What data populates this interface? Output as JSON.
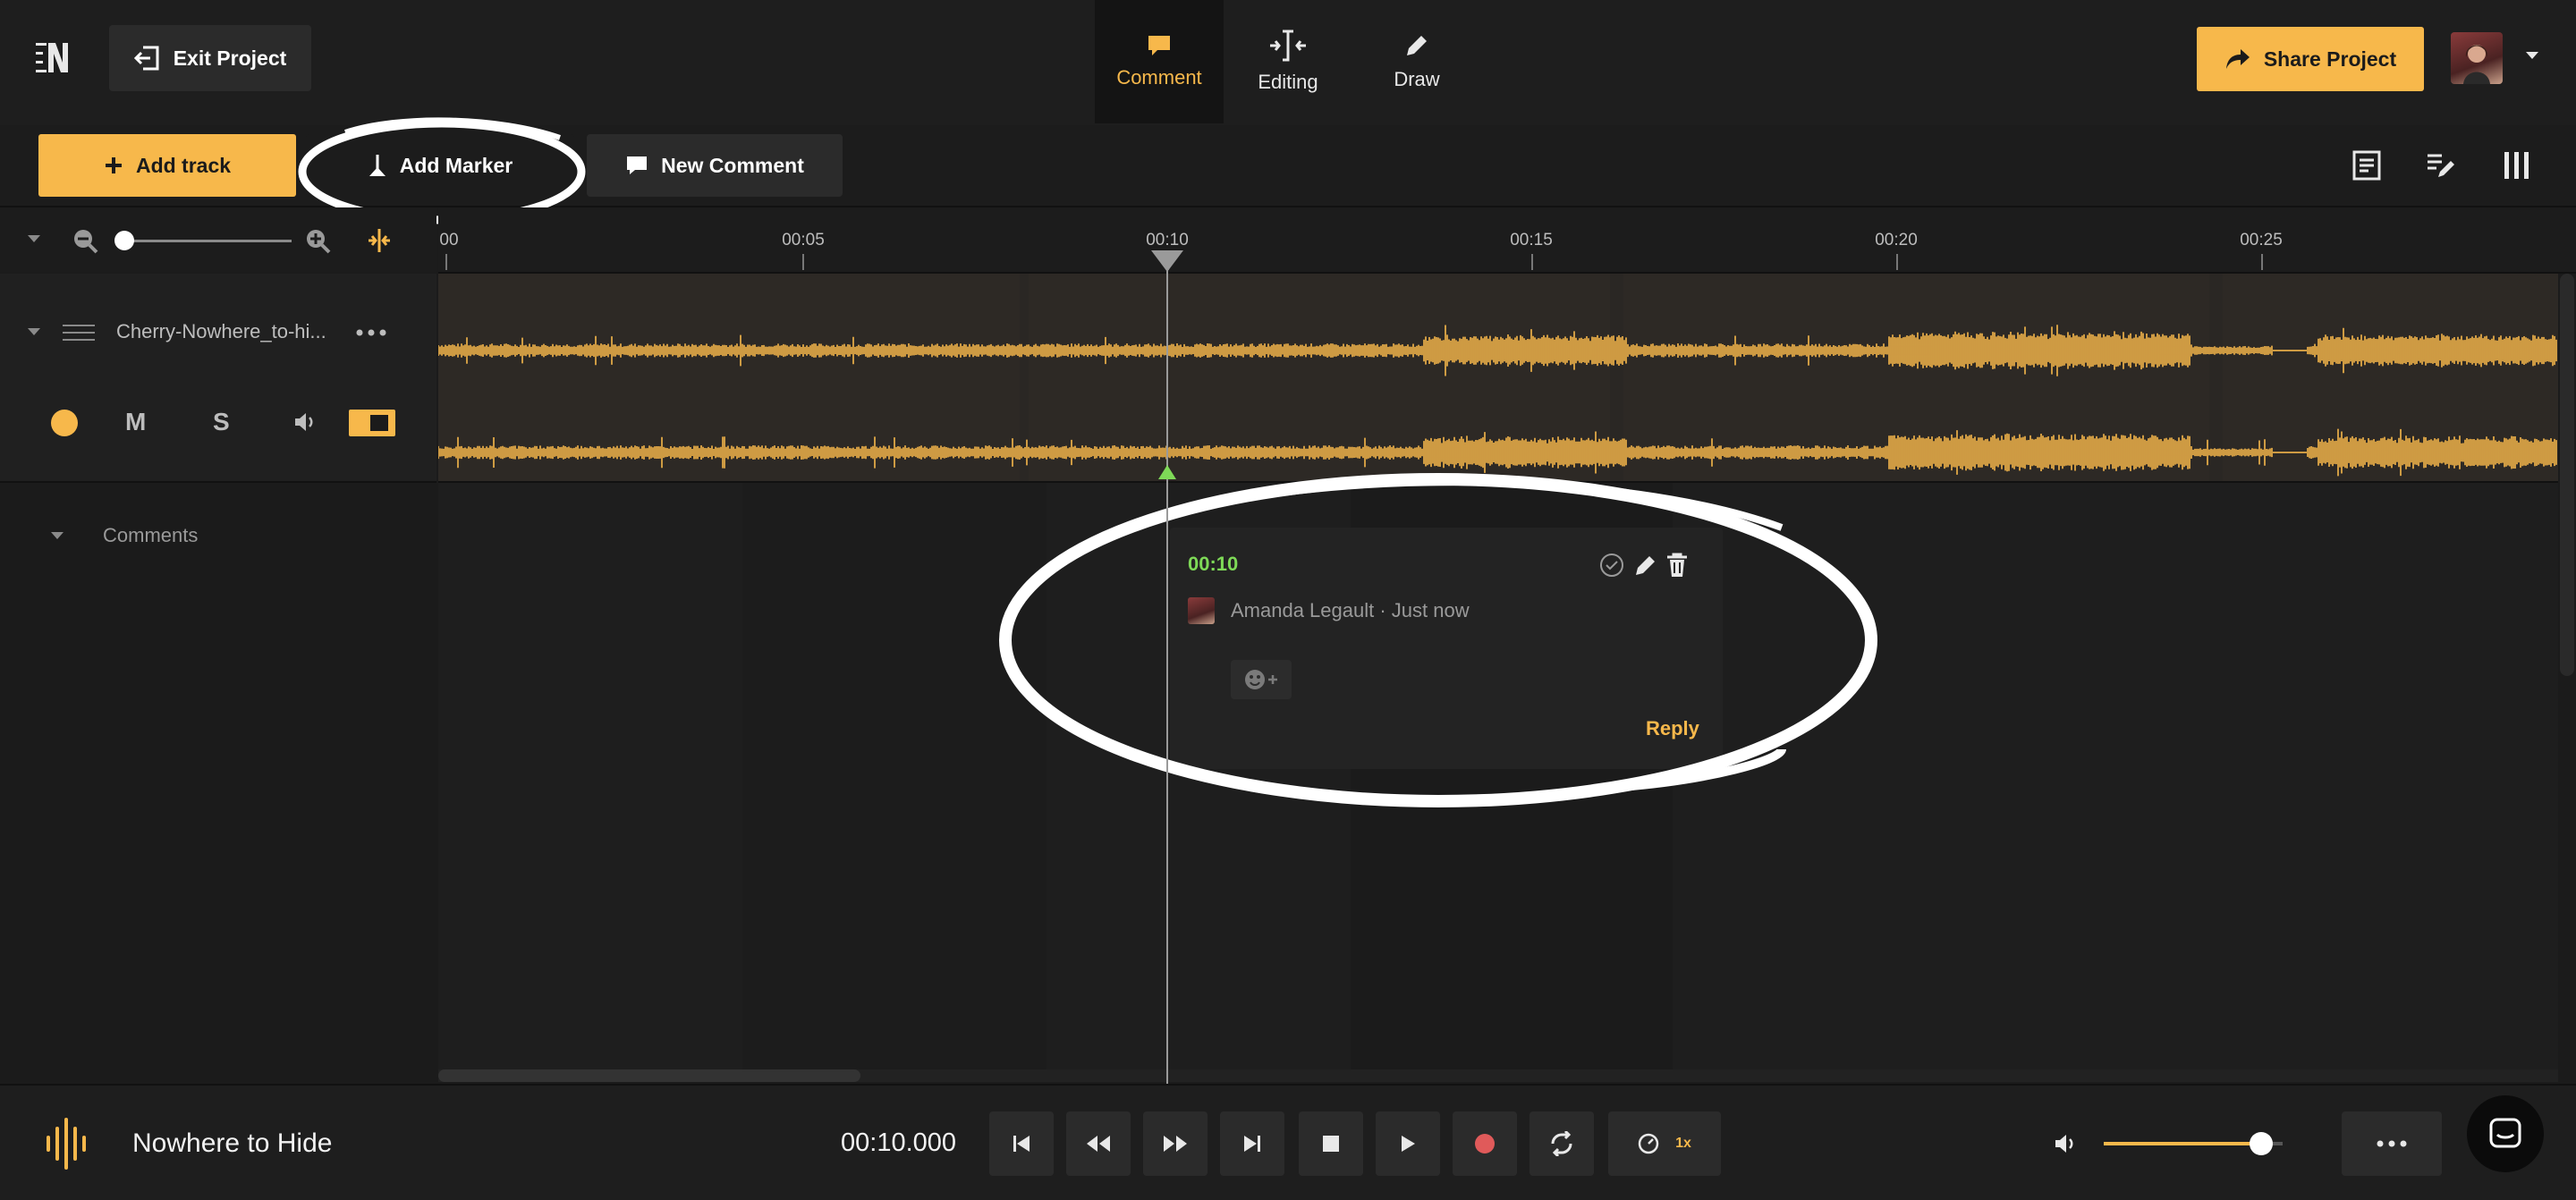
{
  "header": {
    "exit_label": "Exit Project",
    "tabs": [
      {
        "label": "Comment",
        "icon": "comment-icon",
        "active": true
      },
      {
        "label": "Editing",
        "icon": "split-icon",
        "active": false
      },
      {
        "label": "Draw",
        "icon": "pencil-icon",
        "active": false
      }
    ],
    "share_label": "Share Project"
  },
  "toolbar": {
    "add_track_label": "Add track",
    "add_marker_label": "Add Marker",
    "new_comment_label": "New Comment"
  },
  "timeline": {
    "ticks": [
      "00",
      "00:05",
      "00:10",
      "00:15",
      "00:20",
      "00:25"
    ],
    "playhead_time": "00:10"
  },
  "track": {
    "name": "Cherry-Nowhere_to-hi...",
    "mute_label": "M",
    "solo_label": "S"
  },
  "comments": {
    "section_label": "Comments",
    "card": {
      "time": "00:10",
      "author_line": "Amanda Legault · Just now",
      "reply_label": "Reply"
    }
  },
  "transport": {
    "project_title": "Nowhere to Hide",
    "time_display": "00:10.000",
    "speed_label": "1x",
    "volume_level": 0.88
  },
  "colors": {
    "accent": "#f7b84b",
    "marker_green": "#7ed957",
    "record_red": "#e05a5a"
  }
}
